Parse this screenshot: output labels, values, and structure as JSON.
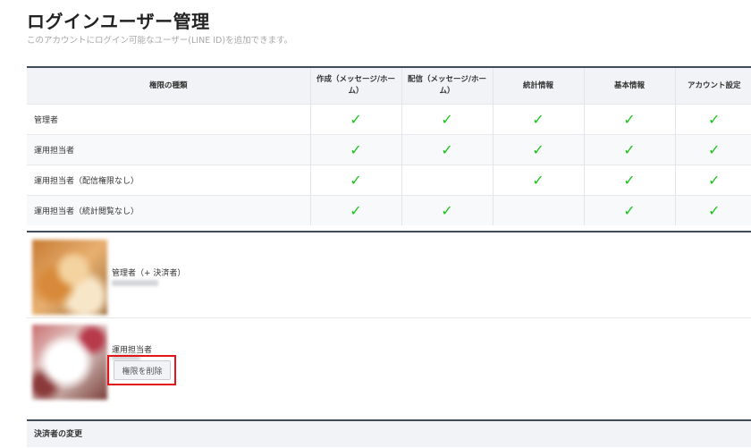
{
  "page": {
    "title": "ログインユーザー管理",
    "subtitle": "このアカウントにログイン可能なユーザー(LINE ID)を追加できます。"
  },
  "permissions": {
    "headers": [
      "権限の種類",
      "作成（メッセージ/ホーム）",
      "配信（メッセージ/ホーム）",
      "統計情報",
      "基本情報",
      "アカウント設定"
    ],
    "rows": [
      {
        "role": "管理者",
        "checks": [
          true,
          true,
          true,
          true,
          true
        ]
      },
      {
        "role": "運用担当者",
        "checks": [
          true,
          true,
          true,
          true,
          true
        ]
      },
      {
        "role": "運用担当者（配信権限なし）",
        "checks": [
          true,
          false,
          true,
          true,
          true
        ]
      },
      {
        "role": "運用担当者（統計閲覧なし）",
        "checks": [
          true,
          true,
          false,
          true,
          true
        ]
      }
    ],
    "check_glyph": "✓",
    "check_color": "#1bc41b"
  },
  "users": [
    {
      "role_label": "管理者（+ 決済者）",
      "avatar": "cat-photo"
    },
    {
      "role_label": "運用担当者",
      "avatar": "dog-photo",
      "action_label": "権限を削除"
    }
  ],
  "payer_section": {
    "label": "決済者の変更"
  },
  "colors": {
    "highlight": "#e3151a",
    "header_border": "#3e4b5b"
  }
}
